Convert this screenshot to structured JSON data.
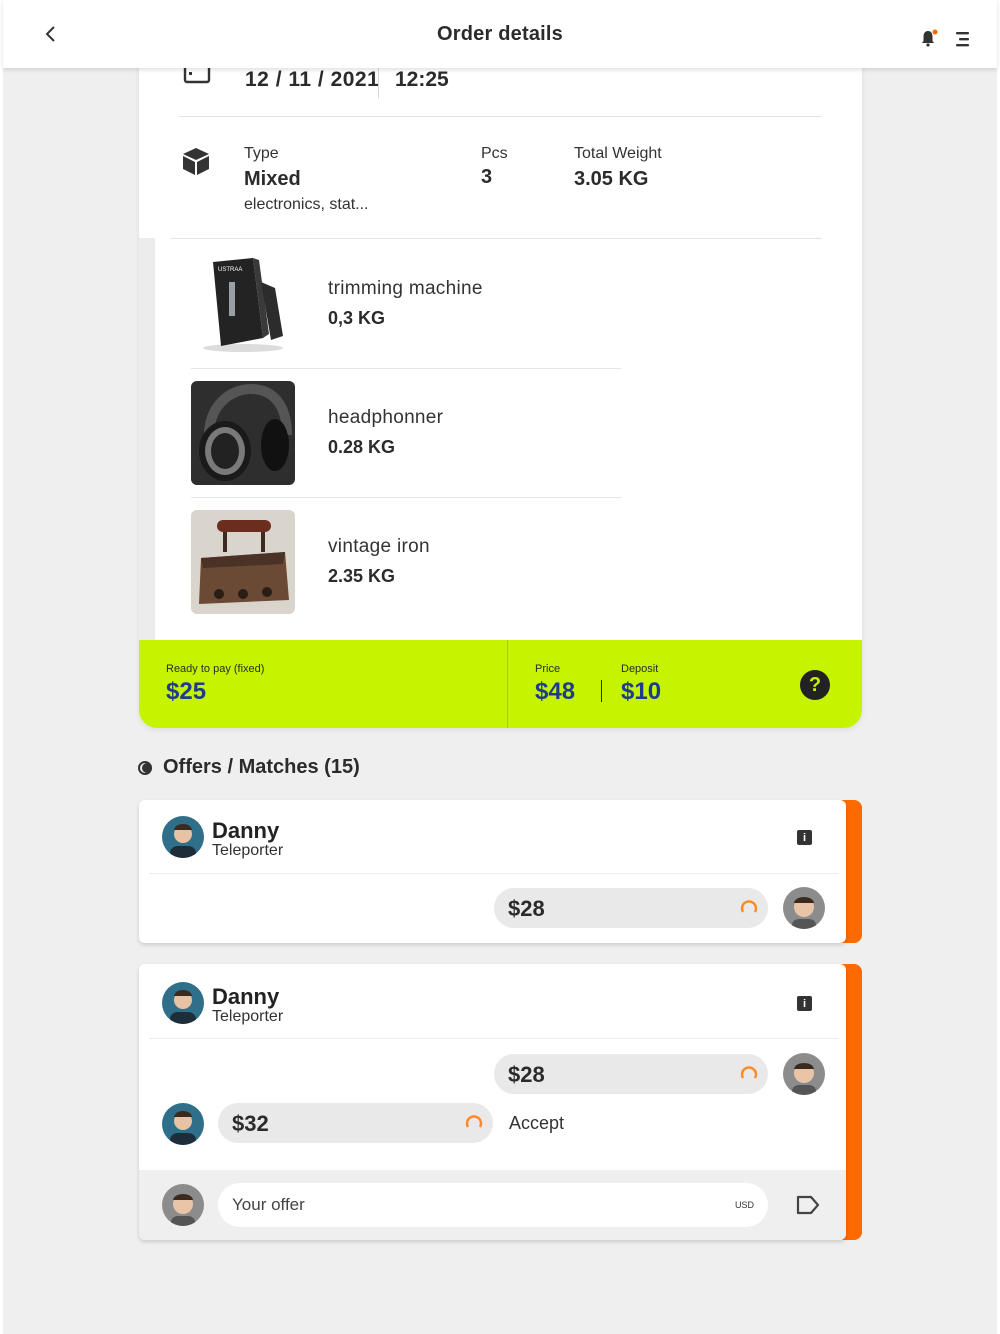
{
  "header": {
    "title": "Order details"
  },
  "order": {
    "date": "12 / 11 / 2021",
    "time": "12:25",
    "type_label": "Type",
    "type_value": "Mixed",
    "type_desc": "electronics, stat...",
    "pcs_label": "Pcs",
    "pcs_value": "3",
    "weight_label": "Total Weight",
    "weight_value": "3.05 KG"
  },
  "items": [
    {
      "name": "trimming machine",
      "weight": "0,3 KG",
      "brand": "USTRAA"
    },
    {
      "name": "headphonner",
      "weight": "0.28 KG"
    },
    {
      "name": "vintage iron",
      "weight": "2.35 KG"
    }
  ],
  "payment": {
    "ready_label": "Ready to pay (fixed)",
    "ready_value": "$25",
    "price_label": "Price",
    "price_value": "$48",
    "deposit_label": "Deposit",
    "deposit_value": "$10",
    "help": "?"
  },
  "offers": {
    "title": "Offers / Matches  (15)",
    "cards": [
      {
        "name": "Danny",
        "role": "Teleporter",
        "amount": "$28"
      },
      {
        "name": "Danny",
        "role": "Teleporter",
        "amount": "$28",
        "counter_amount": "$32",
        "accept_label": "Accept",
        "input_placeholder": "Your offer",
        "currency": "USD"
      }
    ]
  },
  "colors": {
    "accent_green": "#c6f300",
    "accent_orange": "#ff6a00",
    "price_blue": "#1f3c8c"
  }
}
